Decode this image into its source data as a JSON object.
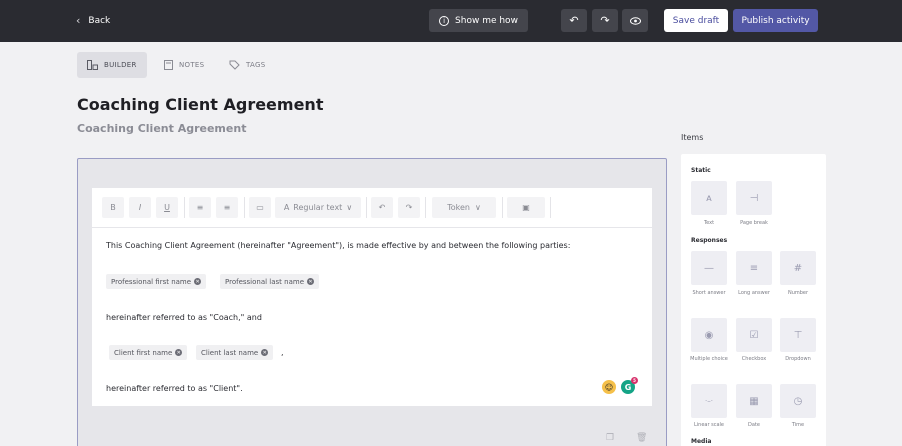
{
  "topbar": {
    "back_label": "Back",
    "show_me_how": "Show me how",
    "save_draft": "Save draft",
    "publish": "Publish activity"
  },
  "tabs": [
    {
      "label": "BUILDER",
      "active": true
    },
    {
      "label": "NOTES",
      "active": false
    },
    {
      "label": "TAGS",
      "active": false
    }
  ],
  "page": {
    "title": "Coaching Client Agreement",
    "subtitle": "Coaching Client Agreement"
  },
  "editor": {
    "toolbar": {
      "bold": "B",
      "italic": "I",
      "underline": "U",
      "text_style": "Regular text",
      "token": "Token"
    },
    "paragraph_1": "This Coaching Client Agreement (hereinafter \"Agreement\"), is made effective by and between the following parties:",
    "chips_row_1": [
      "Professional first name",
      "Professional last name"
    ],
    "paragraph_2": "hereinafter referred to as \"Coach,\" and",
    "chips_row_2": [
      "Client first name",
      "Client last name"
    ],
    "chips_row_2_suffix": ",",
    "paragraph_3": "hereinafter referred to as \"Client\".",
    "grammarly_count": "5"
  },
  "items_panel": {
    "title": "Items",
    "static_heading": "Static",
    "static_items": [
      {
        "label": "Text",
        "icon": "text-icon"
      },
      {
        "label": "Page break",
        "icon": "page-break-icon"
      }
    ],
    "responses_heading": "Responses",
    "response_items": [
      {
        "label": "Short answer",
        "icon": "short-answer-icon"
      },
      {
        "label": "Long answer",
        "icon": "long-answer-icon"
      },
      {
        "label": "Number",
        "icon": "hash-icon"
      },
      {
        "label": "Multiple choice",
        "icon": "radio-icon"
      },
      {
        "label": "Checkbox",
        "icon": "checkbox-icon"
      },
      {
        "label": "Dropdown",
        "icon": "dropdown-icon"
      },
      {
        "label": "Linear scale",
        "icon": "linear-scale-icon"
      },
      {
        "label": "Date",
        "icon": "calendar-icon"
      },
      {
        "label": "Time",
        "icon": "clock-icon"
      }
    ],
    "media_heading": "Media"
  },
  "colors": {
    "topbar_bg": "#2a2b31",
    "accent": "#5358a6",
    "canvas_border": "#9a9cc4"
  }
}
